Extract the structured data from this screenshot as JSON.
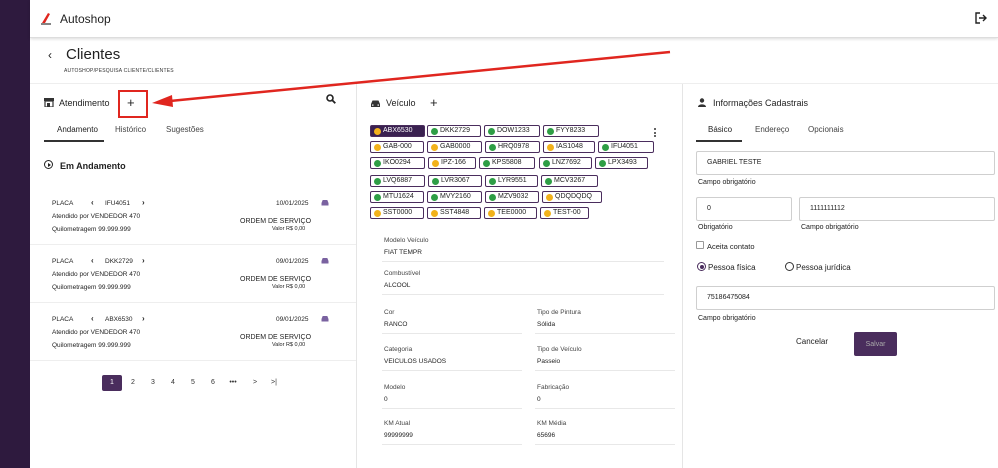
{
  "app": {
    "title": "Autoshop"
  },
  "page": {
    "title": "Clientes",
    "breadcrumb": "AUTOSHOP/PESQUISA CLIENTE/CLIENTES"
  },
  "atendimento": {
    "title": "Atendimento",
    "plus": "+",
    "tabs": [
      "Andamento",
      "Histórico",
      "Sugestões"
    ],
    "section_title": "Em Andamento",
    "cards": [
      {
        "placa_label": "PLACA",
        "placa": "IFU4051",
        "date": "10/01/2025",
        "attended": "Atendido por VENDEDOR 470",
        "os": "ORDEM DE SERVIÇO",
        "km": "Quilometragem 99.999.999",
        "valor": "Valor R$ 0,00"
      },
      {
        "placa_label": "PLACA",
        "placa": "DKK2729",
        "date": "09/01/2025",
        "attended": "Atendido por VENDEDOR 470",
        "os": "ORDEM DE SERVIÇO",
        "km": "Quilometragem 99.999.999",
        "valor": "Valor R$ 0,00"
      },
      {
        "placa_label": "PLACA",
        "placa": "ABX6530",
        "date": "09/01/2025",
        "attended": "Atendido por VENDEDOR 470",
        "os": "ORDEM DE SERVIÇO",
        "km": "Quilometragem 99.999.999",
        "valor": "Valor R$ 0,00"
      }
    ],
    "pagination": [
      "1",
      "2",
      "3",
      "4",
      "5",
      "6",
      "•••",
      ">",
      ">|"
    ],
    "current_page": "1"
  },
  "veiculo": {
    "title": "Veículo",
    "plus": "+",
    "plates": [
      {
        "plate": "ABX6530",
        "status": "yellow",
        "selected": true
      },
      {
        "plate": "DKK2729",
        "status": "green"
      },
      {
        "plate": "DOW1233",
        "status": "green"
      },
      {
        "plate": "FYY8233",
        "status": "green"
      },
      {
        "plate": "GAB-000",
        "status": "yellow"
      },
      {
        "plate": "GAB0000",
        "status": "yellow"
      },
      {
        "plate": "HRQ0978",
        "status": "green"
      },
      {
        "plate": "IAS1048",
        "status": "yellow"
      },
      {
        "plate": "IFU4051",
        "status": "green"
      },
      {
        "plate": "IKO0294",
        "status": "green"
      },
      {
        "plate": "IPZ-166",
        "status": "yellow"
      },
      {
        "plate": "KPS5808",
        "status": "green"
      },
      {
        "plate": "LNZ7692",
        "status": "green"
      },
      {
        "plate": "LPX3493",
        "status": "green"
      },
      {
        "plate": "LVQ6887",
        "status": "green"
      },
      {
        "plate": "LVR3067",
        "status": "green"
      },
      {
        "plate": "LYR9551",
        "status": "green"
      },
      {
        "plate": "MCV3267",
        "status": "green"
      },
      {
        "plate": "MTU1624",
        "status": "green"
      },
      {
        "plate": "MVY2160",
        "status": "green"
      },
      {
        "plate": "MZV9032",
        "status": "green"
      },
      {
        "plate": "QDQDQDQ",
        "status": "yellow"
      },
      {
        "plate": "SST0000",
        "status": "yellow"
      },
      {
        "plate": "SST4848",
        "status": "yellow"
      },
      {
        "plate": "TEE0000",
        "status": "yellow"
      },
      {
        "plate": "TEST-00",
        "status": "yellow"
      }
    ],
    "fields": [
      {
        "label": "Modelo Veículo",
        "value": "FIAT TEMPR"
      },
      {
        "label": "Combustível",
        "value": "ALCOOL"
      },
      {
        "label": "Cor",
        "value": "RANCO"
      },
      {
        "label": "Tipo de Pintura",
        "value": "Sólida"
      },
      {
        "label": "Categoria",
        "value": "VEICULOS USADOS"
      },
      {
        "label": "Tipo de Veículo",
        "value": "Passeio"
      },
      {
        "label": "Modelo",
        "value": "0"
      },
      {
        "label": "Fabricação",
        "value": "0"
      },
      {
        "label": "KM Atual",
        "value": "99999999"
      },
      {
        "label": "KM Média",
        "value": "65696"
      }
    ]
  },
  "info": {
    "title": "Informações Cadastrais",
    "tabs": [
      "Básico",
      "Endereço",
      "Opcionais"
    ],
    "name_value": "GABRIEL TESTE",
    "name_help": "Campo obrigatório",
    "field_a_value": "0",
    "field_a_help": "Obrigatório",
    "field_b_value": "1111111112",
    "field_b_help": "Campo obrigatório",
    "checkbox_label": "Aceita contato",
    "radio_fisica": "Pessoa física",
    "radio_juridica": "Pessoa jurídica",
    "doc_value": "75186475084",
    "doc_help": "Campo obrigatório",
    "cancel": "Cancelar",
    "save": "Salvar"
  },
  "colors": {
    "sidebar": "#2e1a3e",
    "accent": "#4a2d5d",
    "annotation": "#e0261f",
    "green": "#2e9e45",
    "yellow": "#f2b21b"
  }
}
